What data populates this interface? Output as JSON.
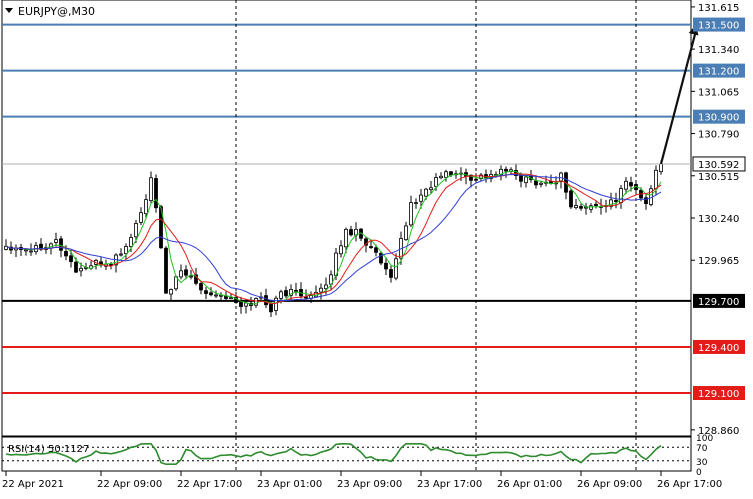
{
  "chart_data": {
    "type": "candlestick",
    "title": "EURJPY@,M30",
    "price_axis": {
      "ylim": [
        128.82,
        131.66
      ],
      "ticks": [
        "131.615",
        "131.340",
        "131.065",
        "130.790",
        "130.515",
        "130.240",
        "129.965",
        "128.860"
      ],
      "tick_values": [
        131.615,
        131.34,
        131.065,
        130.79,
        130.515,
        130.24,
        129.965,
        128.86
      ]
    },
    "time_axis": {
      "labels": [
        "22 Apr 2021",
        "22 Apr 09:00",
        "22 Apr 17:00",
        "23 Apr 01:00",
        "23 Apr 09:00",
        "23 Apr 17:00",
        "26 Apr 01:00",
        "26 Apr 09:00",
        "26 Apr 17:00"
      ],
      "label_bars": [
        0,
        19,
        35,
        51,
        67,
        83,
        99,
        115,
        131
      ]
    },
    "period_separator_bars": [
      46,
      94,
      126
    ],
    "levels": [
      {
        "value": 131.5,
        "label": "131.500",
        "color": "#4a7eb5"
      },
      {
        "value": 131.2,
        "label": "131.200",
        "color": "#4a7eb5"
      },
      {
        "value": 130.9,
        "label": "130.900",
        "color": "#4a7eb5"
      },
      {
        "value": 129.7,
        "label": "129.700",
        "color": "#000000"
      },
      {
        "value": 129.4,
        "label": "129.400",
        "color": "#e41b17"
      },
      {
        "value": 129.1,
        "label": "129.100",
        "color": "#e41b17"
      }
    ],
    "current_price": {
      "value": 130.592,
      "label": "130.592"
    },
    "forecast_arrow": {
      "from_bar": 131,
      "from_price": 130.592,
      "to_bar": 138,
      "to_price": 131.5
    },
    "anchors": [
      [
        0,
        130.06
      ],
      [
        5,
        130.04
      ],
      [
        10,
        130.09
      ],
      [
        14,
        129.9
      ],
      [
        18,
        129.94
      ],
      [
        21,
        129.95
      ],
      [
        24,
        130.05
      ],
      [
        27,
        130.27
      ],
      [
        29,
        130.48
      ],
      [
        30,
        130.3
      ],
      [
        32,
        129.75
      ],
      [
        35,
        129.88
      ],
      [
        37,
        129.86
      ],
      [
        40,
        129.76
      ],
      [
        44,
        129.73
      ],
      [
        47,
        129.66
      ],
      [
        51,
        129.72
      ],
      [
        53,
        129.65
      ],
      [
        55,
        129.75
      ],
      [
        58,
        129.76
      ],
      [
        61,
        129.73
      ],
      [
        64,
        129.78
      ],
      [
        66,
        130.0
      ],
      [
        68,
        130.15
      ],
      [
        70,
        130.16
      ],
      [
        72,
        130.08
      ],
      [
        74,
        130.0
      ],
      [
        77,
        129.83
      ],
      [
        79,
        130.1
      ],
      [
        81,
        130.32
      ],
      [
        84,
        130.42
      ],
      [
        87,
        130.52
      ],
      [
        90,
        130.53
      ],
      [
        93,
        130.5
      ],
      [
        97,
        130.52
      ],
      [
        100,
        130.55
      ],
      [
        103,
        130.5
      ],
      [
        106,
        130.48
      ],
      [
        109,
        130.46
      ],
      [
        111,
        130.52
      ],
      [
        113,
        130.32
      ],
      [
        116,
        130.3
      ],
      [
        119,
        130.33
      ],
      [
        122,
        130.34
      ],
      [
        124,
        130.5
      ],
      [
        126,
        130.42
      ],
      [
        128,
        130.33
      ],
      [
        130,
        130.56
      ],
      [
        131,
        130.592
      ]
    ],
    "rsi": {
      "label": "RSI(14) 50.1127",
      "ylim": [
        0,
        100
      ],
      "ticks": [
        "100",
        "70",
        "30",
        "0"
      ],
      "tick_values": [
        100,
        70,
        30,
        0
      ],
      "value": 50.1127
    }
  }
}
